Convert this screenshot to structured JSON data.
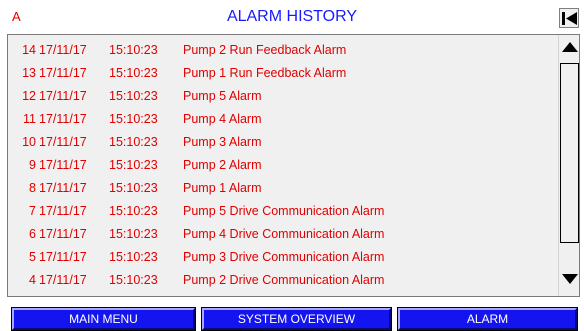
{
  "header": {
    "indicator": "A",
    "title": "ALARM HISTORY"
  },
  "alarms": [
    {
      "num": "14",
      "date": "17/11/17",
      "time": "15:10:23",
      "message": "Pump 2 Run Feedback Alarm"
    },
    {
      "num": "13",
      "date": "17/11/17",
      "time": "15:10:23",
      "message": "Pump 1 Run Feedback Alarm"
    },
    {
      "num": "12",
      "date": "17/11/17",
      "time": "15:10:23",
      "message": "Pump 5 Alarm"
    },
    {
      "num": "11",
      "date": "17/11/17",
      "time": "15:10:23",
      "message": "Pump 4 Alarm"
    },
    {
      "num": "10",
      "date": "17/11/17",
      "time": "15:10:23",
      "message": "Pump 3 Alarm"
    },
    {
      "num": "9",
      "date": "17/11/17",
      "time": "15:10:23",
      "message": "Pump 2 Alarm"
    },
    {
      "num": "8",
      "date": "17/11/17",
      "time": "15:10:23",
      "message": "Pump 1 Alarm"
    },
    {
      "num": "7",
      "date": "17/11/17",
      "time": "15:10:23",
      "message": "Pump 5 Drive Communication Alarm"
    },
    {
      "num": "6",
      "date": "17/11/17",
      "time": "15:10:23",
      "message": "Pump 4 Drive Communication Alarm"
    },
    {
      "num": "5",
      "date": "17/11/17",
      "time": "15:10:23",
      "message": "Pump 3 Drive Communication Alarm"
    },
    {
      "num": "4",
      "date": "17/11/17",
      "time": "15:10:23",
      "message": "Pump 2 Drive Communication Alarm"
    }
  ],
  "nav": {
    "main_menu": "MAIN MENU",
    "system_overview": "SYSTEM OVERVIEW",
    "alarm": "ALARM"
  },
  "colors": {
    "alarm_text": "#e00000",
    "title": "#1a1aff",
    "nav_button": "#1414f0"
  },
  "icons": {
    "first_page": "skip-to-start-icon",
    "scroll_up": "triangle-up-icon",
    "scroll_down": "triangle-down-icon"
  }
}
